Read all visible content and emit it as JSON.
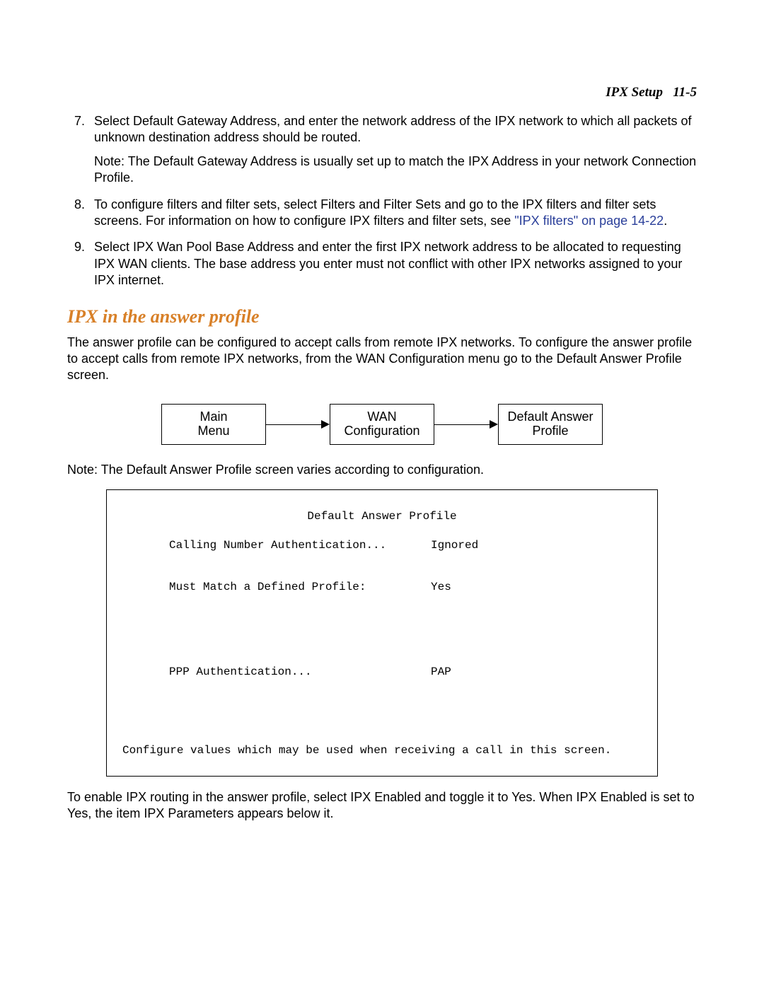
{
  "header": {
    "section": "IPX Setup",
    "page_ref": "11-5"
  },
  "steps": {
    "start": 7,
    "items": [
      {
        "main": "Select Default Gateway Address, and enter the network address of the IPX network to which all packets of unknown destination address should be routed.",
        "note": "Note: The Default Gateway Address is usually set up to match the IPX Address in your network Connection Profile."
      },
      {
        "main_pre_link": "To configure filters and filter sets, select Filters and Filter Sets and go to the IPX filters and filter sets screens. For information on how to configure IPX filters and filter sets, see ",
        "link_text": "\"IPX filters\" on page 14-22",
        "main_post_link": "."
      },
      {
        "main": "Select IPX Wan Pool Base Address and enter the first IPX network address to be allocated to requesting IPX WAN clients. The base address you enter must not conflict with other IPX networks assigned to your IPX internet."
      }
    ]
  },
  "section_heading": "IPX in the answer profile",
  "intro_paragraph": "The answer profile can be configured to accept calls from remote IPX networks. To configure the answer profile to accept calls from remote IPX networks, from the WAN Configuration menu go to the Default Answer Profile screen.",
  "breadcrumb": {
    "node1_line1": "Main",
    "node1_line2": "Menu",
    "node2_line1": "WAN",
    "node2_line2": "Configuration",
    "node3_line1": "Default Answer",
    "node3_line2": "Profile"
  },
  "note_below_diagram": "Note: The Default Answer Profile screen varies according to configuration.",
  "terminal": {
    "title": "Default Answer Profile",
    "rows": [
      {
        "label": "Calling Number Authentication...",
        "value": "Ignored"
      },
      {
        "label": "Must Match a Defined Profile:",
        "value": "Yes"
      },
      {
        "label": "PPP Authentication...",
        "value": "PAP"
      }
    ],
    "footer": "Configure values which may be used when receiving a call in this screen."
  },
  "trailing_paragraph": "To enable IPX routing in the answer profile, select IPX Enabled and toggle it to Yes. When IPX Enabled is set to Yes, the item IPX Parameters appears below it."
}
